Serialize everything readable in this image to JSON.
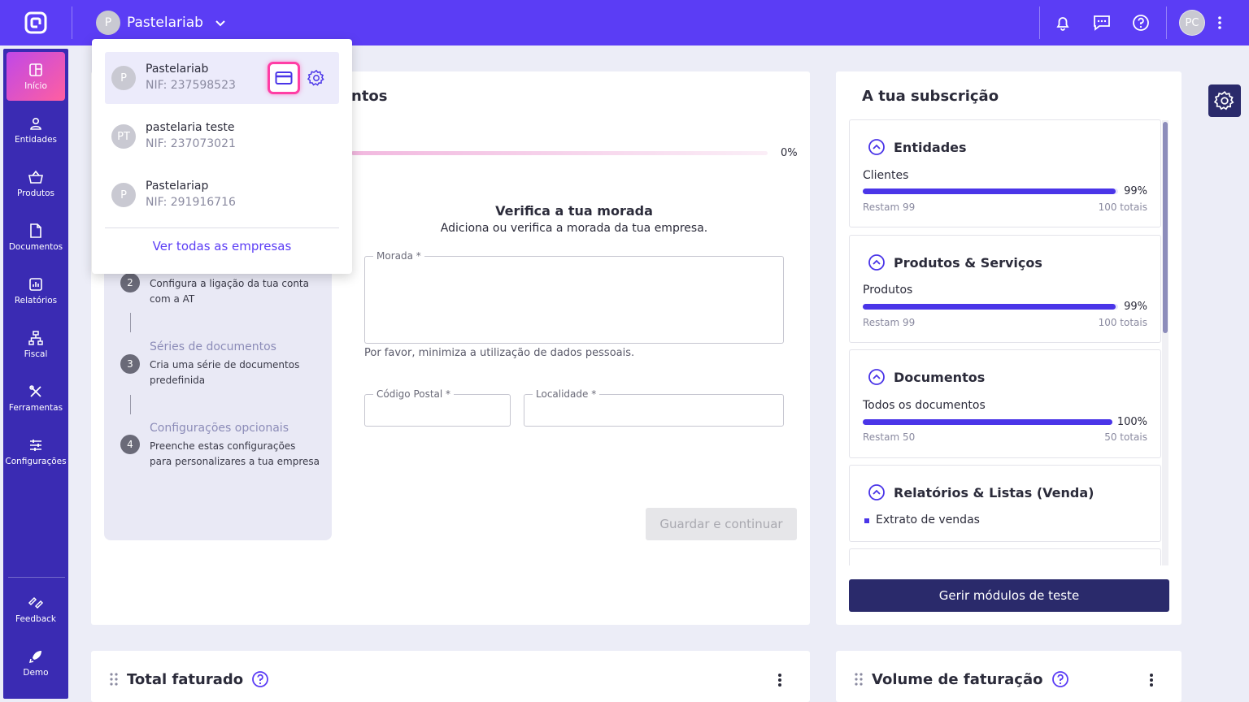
{
  "topbar": {
    "company_avatar": "P",
    "company_name": "Pastelariab",
    "user_initials": "PC",
    "icons": [
      "logo-icon",
      "chevron-down-icon",
      "bell-icon",
      "chat-icon",
      "help-icon",
      "more-vertical-icon"
    ]
  },
  "sidebar": {
    "items": [
      {
        "label": "Início",
        "icon": "dashboard-icon"
      },
      {
        "label": "Entidades",
        "icon": "user-icon"
      },
      {
        "label": "Produtos",
        "icon": "basket-icon"
      },
      {
        "label": "Documentos",
        "icon": "document-icon"
      },
      {
        "label": "Relatórios",
        "icon": "chart-icon"
      },
      {
        "label": "Fiscal",
        "icon": "hierarchy-icon"
      },
      {
        "label": "Ferramentas",
        "icon": "tools-icon"
      },
      {
        "label": "Configurações",
        "icon": "sliders-icon"
      }
    ],
    "bottom_items": [
      {
        "label": "Feedback",
        "icon": "feedback-icon"
      },
      {
        "label": "Demo",
        "icon": "rocket-icon"
      }
    ]
  },
  "dropdown": {
    "companies": [
      {
        "avatar": "P",
        "name": "Pastelariab",
        "nif": "NIF: 237598523"
      },
      {
        "avatar": "PT",
        "name": "pastelaria teste",
        "nif": "NIF: 237073021"
      },
      {
        "avatar": "P",
        "name": "Pastelariap",
        "nif": "NIF: 291916716"
      }
    ],
    "see_all": "Ver todas as empresas"
  },
  "setup": {
    "title_partial": "ntos",
    "progress_pct": "0%",
    "progress_value": 0,
    "steps": [
      {
        "num": "2",
        "title": "",
        "desc": "Configura a ligação da tua conta com a AT"
      },
      {
        "num": "3",
        "title": "Séries de documentos",
        "desc": "Cria uma série de documentos predefinida"
      },
      {
        "num": "4",
        "title": "Configurações opcionais",
        "desc": "Preenche estas configurações para personalizares a tua empresa"
      }
    ],
    "form_title": "Verifica a tua morada",
    "form_subtitle": "Adiciona ou verifica a morada da tua empresa.",
    "morada_label": "Morada *",
    "morada_hint": "Por favor, minimiza a utilização de dados pessoais.",
    "postal_label": "Código Postal *",
    "locality_label": "Localidade *",
    "save_button": "Guardar e continuar"
  },
  "subscription": {
    "title": "A tua subscrição",
    "modules": [
      {
        "heading": "Entidades",
        "item": "Clientes",
        "pct": "99%",
        "fill": 0.99,
        "remaining": "Restam 99",
        "total": "100 totais"
      },
      {
        "heading": "Produtos & Serviços",
        "item": "Produtos",
        "pct": "99%",
        "fill": 0.99,
        "remaining": "Restam 99",
        "total": "100 totais"
      },
      {
        "heading": "Documentos",
        "item": "Todos os documentos",
        "pct": "100%",
        "fill": 1.0,
        "remaining": "Restam 50",
        "total": "50 totais"
      },
      {
        "heading": "Relatórios & Listas (Venda)",
        "item": "Extrato de vendas"
      }
    ],
    "manage_button": "Gerir módulos de teste"
  },
  "bottom_cards": {
    "total_faturado": "Total faturado",
    "volume_faturacao": "Volume de faturação"
  },
  "colors": {
    "primary": "#5b3df5",
    "sidebar": "#3a2bb3",
    "dark_button": "#2a2a6b",
    "highlight": "#ff3ea5"
  }
}
